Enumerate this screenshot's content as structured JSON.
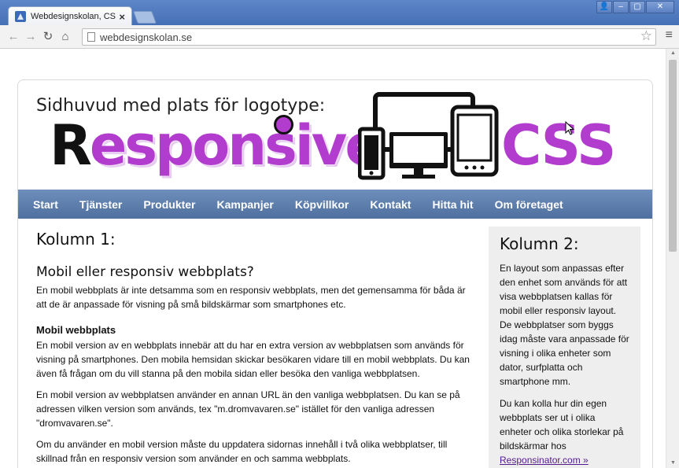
{
  "browser": {
    "tab_title": "Webdesignskolan, CSS lay",
    "tab_close": "×",
    "url": "webdesignskolan.se",
    "back_icon": "arrow-left",
    "forward_icon": "arrow-right",
    "reload_icon": "reload",
    "home_icon": "home",
    "bookmark_icon": "star",
    "menu_icon": "hamburger-menu"
  },
  "header": {
    "label": "Sidhuvud med plats för logotype:",
    "logo_first_letter": "R",
    "logo_rest": "esponsive",
    "logo_css": "CSS"
  },
  "nav": {
    "items": [
      "Start",
      "Tjänster",
      "Produkter",
      "Kampanjer",
      "Köpvillkor",
      "Kontakt",
      "Hitta hit",
      "Om företaget"
    ]
  },
  "column1": {
    "title": "Kolumn 1:",
    "heading": "Mobil eller responsiv webbplats?",
    "intro": "En mobil webbplats är inte detsamma som en responsiv webbplats, men det gemensamma för båda är att de är anpassade för visning på små bildskärmar som smartphones etc.",
    "subheading": "Mobil webbplats",
    "p1": "En mobil version av en webbplats innebär att du har en extra version av webbplatsen som används för visning på smartphones. Den mobila hemsidan skickar besökaren vidare till en mobil webbplats. Du kan även få frågan om du vill stanna på den mobila sidan eller besöka den vanliga webbplatsen.",
    "p2": "En mobil version av webbplatsen använder en annan URL än den vanliga webbplatsen. Du kan se på adressen vilken version som används, tex \"m.dromvavaren.se\" istället för den vanliga adressen \"dromvavaren.se\".",
    "p3": "Om du använder en mobil version måste du uppdatera sidornas innehåll i två olika webbplatser, till skillnad från en responsiv version som använder en och samma webbplats."
  },
  "column2": {
    "title": "Kolumn 2:",
    "p1": "En layout som anpassas efter den enhet som används för att visa webbplatsen kallas för mobil eller responsiv layout. De webbplatser som byggs idag måste vara anpassade för visning i olika enheter som dator, surfplatta och smartphone mm.",
    "p2": "Du kan kolla hur din egen webbplats ser ut i olika enheter och olika storlekar på bildskärmar hos",
    "link": "Responsinator.com »"
  }
}
